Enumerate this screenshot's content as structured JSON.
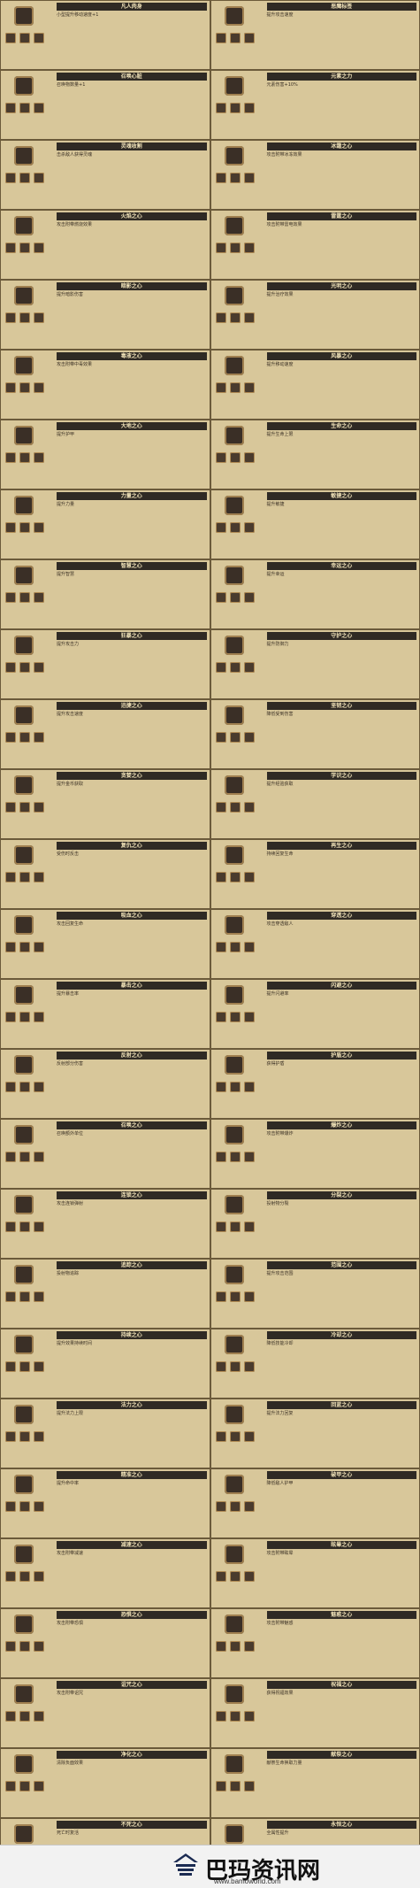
{
  "items": [
    {
      "title": "凡人肉身",
      "desc": "小型提升移动速度+1"
    },
    {
      "title": "恶魔标签",
      "desc": "提升攻击速度"
    },
    {
      "title": "召唤心脏",
      "desc": "召唤物数量+1"
    },
    {
      "title": "元素之力",
      "desc": "元素伤害+10%"
    },
    {
      "title": "灵魂收割",
      "desc": "击杀敌人获得灵魂"
    },
    {
      "title": "冰霜之心",
      "desc": "攻击附带冰冻效果"
    },
    {
      "title": "火焰之心",
      "desc": "攻击附带燃烧效果"
    },
    {
      "title": "雷霆之心",
      "desc": "攻击附带雷电效果"
    },
    {
      "title": "暗影之心",
      "desc": "提升暗影伤害"
    },
    {
      "title": "光明之心",
      "desc": "提升治疗效果"
    },
    {
      "title": "毒液之心",
      "desc": "攻击附带中毒效果"
    },
    {
      "title": "风暴之心",
      "desc": "提升移动速度"
    },
    {
      "title": "大地之心",
      "desc": "提升护甲"
    },
    {
      "title": "生命之心",
      "desc": "提升生命上限"
    },
    {
      "title": "力量之心",
      "desc": "提升力量"
    },
    {
      "title": "敏捷之心",
      "desc": "提升敏捷"
    },
    {
      "title": "智慧之心",
      "desc": "提升智慧"
    },
    {
      "title": "幸运之心",
      "desc": "提升幸运"
    },
    {
      "title": "狂暴之心",
      "desc": "提升攻击力"
    },
    {
      "title": "守护之心",
      "desc": "提升防御力"
    },
    {
      "title": "迅捷之心",
      "desc": "提升攻击速度"
    },
    {
      "title": "坚韧之心",
      "desc": "降低受到伤害"
    },
    {
      "title": "贪婪之心",
      "desc": "提升金币获取"
    },
    {
      "title": "学识之心",
      "desc": "提升经验获取"
    },
    {
      "title": "复仇之心",
      "desc": "受伤时反击"
    },
    {
      "title": "再生之心",
      "desc": "持续回复生命"
    },
    {
      "title": "吸血之心",
      "desc": "攻击回复生命"
    },
    {
      "title": "穿透之心",
      "desc": "攻击穿透敌人"
    },
    {
      "title": "暴击之心",
      "desc": "提升暴击率"
    },
    {
      "title": "闪避之心",
      "desc": "提升闪避率"
    },
    {
      "title": "反射之心",
      "desc": "反射部分伤害"
    },
    {
      "title": "护盾之心",
      "desc": "获得护盾"
    },
    {
      "title": "召唤之心",
      "desc": "召唤额外单位"
    },
    {
      "title": "爆炸之心",
      "desc": "攻击附带爆炸"
    },
    {
      "title": "连锁之心",
      "desc": "攻击连锁弹射"
    },
    {
      "title": "分裂之心",
      "desc": "投射物分裂"
    },
    {
      "title": "追踪之心",
      "desc": "投射物追踪"
    },
    {
      "title": "范围之心",
      "desc": "提升攻击范围"
    },
    {
      "title": "持续之心",
      "desc": "提升效果持续时间"
    },
    {
      "title": "冷却之心",
      "desc": "降低技能冷却"
    },
    {
      "title": "法力之心",
      "desc": "提升法力上限"
    },
    {
      "title": "回蓝之心",
      "desc": "提升法力回复"
    },
    {
      "title": "精准之心",
      "desc": "提升命中率"
    },
    {
      "title": "破甲之心",
      "desc": "降低敌人护甲"
    },
    {
      "title": "减速之心",
      "desc": "攻击附带减速"
    },
    {
      "title": "眩晕之心",
      "desc": "攻击附带眩晕"
    },
    {
      "title": "恐惧之心",
      "desc": "攻击附带恐惧"
    },
    {
      "title": "魅惑之心",
      "desc": "攻击附带魅惑"
    },
    {
      "title": "诅咒之心",
      "desc": "攻击附带诅咒"
    },
    {
      "title": "祝福之心",
      "desc": "获得祝福效果"
    },
    {
      "title": "净化之心",
      "desc": "清除负面效果"
    },
    {
      "title": "献祭之心",
      "desc": "献祭生命换取力量"
    },
    {
      "title": "不死之心",
      "desc": "死亡时复活"
    },
    {
      "title": "永恒之心",
      "desc": "全属性提升"
    }
  ],
  "footer": {
    "brand": "巴玛资讯网",
    "url": "www.bamoworld.com"
  }
}
